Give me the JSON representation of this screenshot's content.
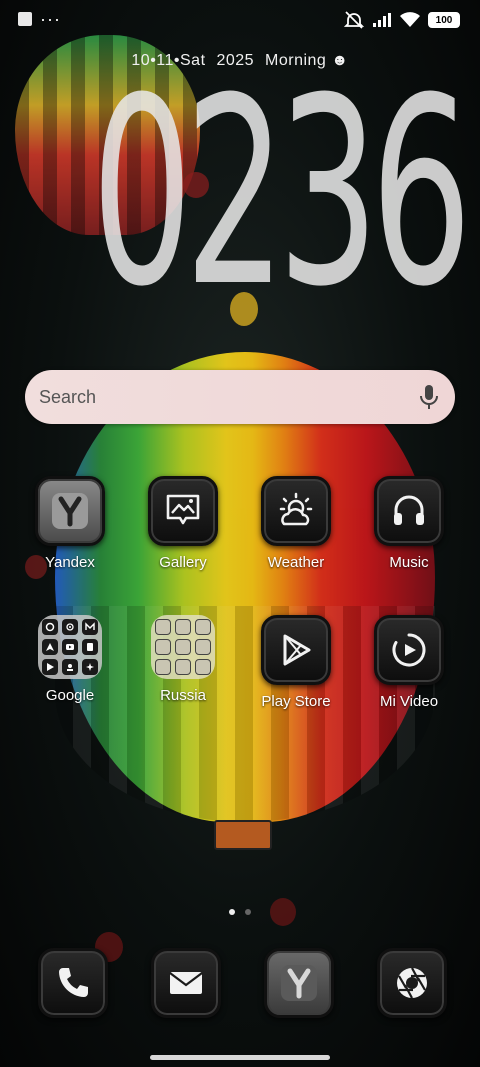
{
  "status_bar": {
    "battery": "100",
    "icons": [
      "notification-square-icon",
      "more-dots-icon",
      "alarm-off-icon",
      "signal-icon",
      "wifi-icon",
      "battery-icon"
    ]
  },
  "date_line": {
    "date": "10•11•Sat",
    "year": "2025",
    "greeting": "Morning ☻"
  },
  "clock": {
    "time": "0236"
  },
  "search": {
    "placeholder": "Search"
  },
  "apps": [
    {
      "label": "Yandex",
      "icon": "yandex-icon"
    },
    {
      "label": "Gallery",
      "icon": "gallery-icon"
    },
    {
      "label": "Weather",
      "icon": "weather-icon"
    },
    {
      "label": "Music",
      "icon": "headphones-icon"
    },
    {
      "label": "Google",
      "icon": "folder-icon"
    },
    {
      "label": "Russia",
      "icon": "folder-icon"
    },
    {
      "label": "Play Store",
      "icon": "play-store-icon"
    },
    {
      "label": "Mi Video",
      "icon": "video-icon"
    }
  ],
  "dock": [
    "phone-icon",
    "mail-icon",
    "yandex-browser-icon",
    "camera-icon"
  ],
  "page_indicator": {
    "pages": 2,
    "active": 0
  },
  "colors": {
    "search_bg": "#f1dedd",
    "icon_bg": "#1a1a1a",
    "icon_glyph": "#f2f2f2"
  }
}
